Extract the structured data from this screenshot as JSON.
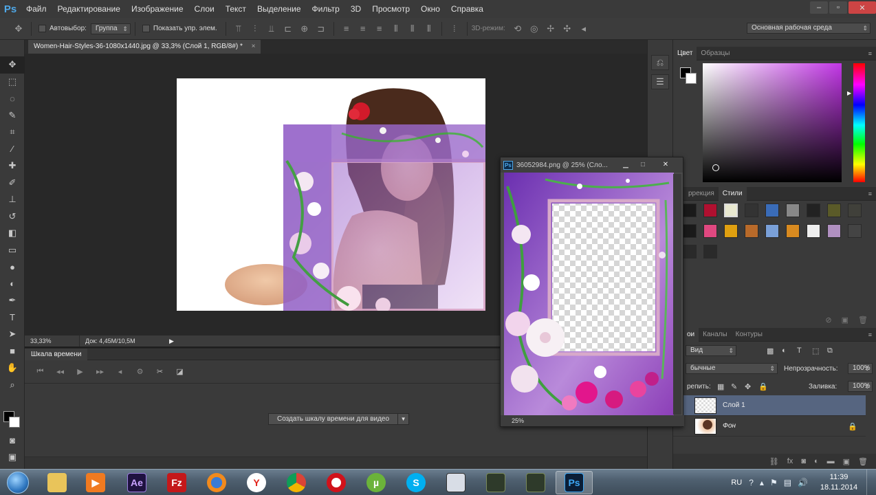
{
  "app": {
    "logo": "Ps",
    "menu": [
      "Файл",
      "Редактирование",
      "Изображение",
      "Слои",
      "Текст",
      "Выделение",
      "Фильтр",
      "3D",
      "Просмотр",
      "Окно",
      "Справка"
    ]
  },
  "options_bar": {
    "autoselect_label": "Автовыбор:",
    "autoselect_value": "Группа",
    "show_transform_label": "Показать упр. элем.",
    "mode_3d_label": "3D-режим:",
    "workspace": "Основная рабочая среда"
  },
  "document": {
    "tab_title": "Women-Hair-Styles-36-1080x1440.jpg @ 33,3% (Слой 1, RGB/8#) *",
    "close_glyph": "×",
    "zoom": "33,33%",
    "doc_info": "Док: 4,45M/10,5M"
  },
  "timeline": {
    "tab_label": "Шкала времени",
    "create_button": "Создать шкалу времени для видео"
  },
  "floating_window": {
    "title": "36052984.png @ 25% (Сло...",
    "zoom": "25%"
  },
  "color_panel": {
    "tabs": [
      "Цвет",
      "Образцы"
    ],
    "field_hue_color": "#c236e6"
  },
  "styles_panel": {
    "tabs": [
      "Коррекция",
      "Стили"
    ],
    "tabs_visible": [
      "ррекция",
      "Стили"
    ]
  },
  "layers_panel": {
    "tabs_visible": [
      "ои",
      "Каналы",
      "Контуры"
    ],
    "filter_value": "Вид",
    "blend_mode": "бычные",
    "opacity_label": "Непрозрачность:",
    "opacity_value": "100%",
    "lock_label": "репить:",
    "fill_label": "Заливка:",
    "fill_value": "100%",
    "layers": [
      {
        "name": "Слой 1",
        "selected": true
      },
      {
        "name": "Фон",
        "selected": false
      }
    ]
  },
  "taskbar": {
    "language": "RU",
    "time": "11:39",
    "date": "18.11.2014",
    "apps": [
      "explorer",
      "media-player",
      "after-effects",
      "filezilla",
      "firefox",
      "yandex",
      "chrome",
      "opera",
      "utorrent",
      "skype",
      "app-1",
      "app-2",
      "app-3",
      "photoshop"
    ],
    "app_labels": {
      "after_effects": "Ae",
      "filezilla": "Fz",
      "photoshop": "Ps",
      "skype": "S",
      "utorrent": "µ",
      "yandex": "Y"
    }
  }
}
